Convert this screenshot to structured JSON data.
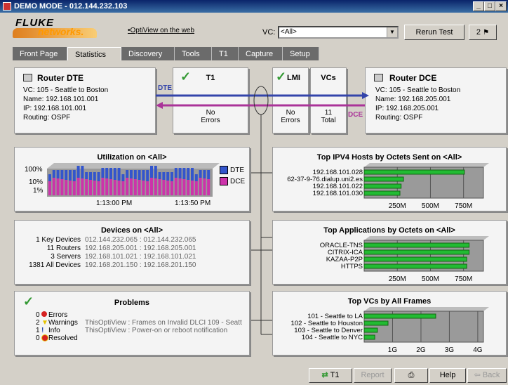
{
  "window": {
    "title": "DEMO MODE - 012.144.232.103",
    "min": "_",
    "max": "□",
    "close": "×"
  },
  "header": {
    "logo_top": "FLUKE",
    "logo_bottom": "networks.",
    "web_link": "OptiView on the web",
    "vc_label": "VC:",
    "vc_value": "<All>",
    "rerun_label": "Rerun Test",
    "alert_count": "2"
  },
  "tabs": [
    "Front Page",
    "Statistics",
    "Discovery",
    "Tools",
    "T1",
    "Capture",
    "Setup"
  ],
  "router_dte": {
    "title": "Router DTE",
    "vc": "VC: 105 - Seattle to Boston",
    "name": "Name: 192.168.101.001",
    "ip": "IP: 192.168.101.001",
    "routing": "Routing: OSPF"
  },
  "t1": {
    "title": "T1",
    "status1": "No",
    "status2": "Errors"
  },
  "lmi": {
    "title": "LMI",
    "status1": "No",
    "status2": "Errors"
  },
  "vcs": {
    "title": "VCs",
    "count": "11",
    "total": "Total"
  },
  "router_dce": {
    "title": "Router DCE",
    "vc": "VC: 105 - Seattle to Boston",
    "name": "Name: 192.168.205.001",
    "ip": "IP: 192.168.205.001",
    "routing": "Routing: OSPF"
  },
  "link": {
    "dte": "DTE",
    "dce": "DCE"
  },
  "utilization": {
    "title": "Utilization on <All>",
    "ylabels": [
      "100%",
      "10%",
      "1%"
    ],
    "xlabels": [
      "1:13:00 PM",
      "1:13:50 PM"
    ],
    "legend": [
      {
        "name": "DTE",
        "color": "#3355cc"
      },
      {
        "name": "DCE",
        "color": "#cc33aa"
      }
    ]
  },
  "devices": {
    "title": "Devices on <All>",
    "rows": [
      {
        "label": "1 Key Devices",
        "value": "012.144.232.065 : 012.144.232.065"
      },
      {
        "label": "11 Routers",
        "value": "192.168.205.001 : 192.168.205.001"
      },
      {
        "label": "3 Servers",
        "value": "192.168.101.021 : 192.168.101.021"
      },
      {
        "label": "1381 All Devices",
        "value": "192.168.201.150 : 192.168.201.150"
      }
    ]
  },
  "problems": {
    "title": "Problems",
    "rows": [
      {
        "count": "0",
        "label": "Errors",
        "detail": ""
      },
      {
        "count": "2",
        "label": "Warnings",
        "detail": "ThisOptiView : Frames on Invalid DLCI 109 - Seatt"
      },
      {
        "count": "1",
        "label": "Info",
        "detail": "ThisOptiView : Power-on or reboot notification"
      },
      {
        "count": "0",
        "label": "Resolved",
        "detail": ""
      }
    ]
  },
  "top_hosts": {
    "title": "Top IPV4 Hosts by Octets Sent on <All>",
    "xlabels": [
      "250M",
      "500M",
      "750M"
    ]
  },
  "top_apps": {
    "title": "Top Applications by Octets on <All>",
    "xlabels": [
      "250M",
      "500M",
      "750M"
    ]
  },
  "top_vcs": {
    "title": "Top VCs by All Frames",
    "xlabels": [
      "1G",
      "2G",
      "3G",
      "4G"
    ]
  },
  "chart_data": [
    {
      "type": "bar",
      "title": "Top IPV4 Hosts by Octets Sent on <All>",
      "categories": [
        "192.168.101.028",
        "62-37-9-76.dialup.uni2.es",
        "192.168.101.022",
        "192.168.101.030"
      ],
      "values": [
        840,
        330,
        310,
        300
      ],
      "xlim": [
        0,
        1000
      ]
    },
    {
      "type": "bar",
      "title": "Top Applications by Octets on <All>",
      "categories": [
        "ORACLE-TNS",
        "CITRIX-ICA",
        "KAZAA-P2P",
        "HTTPS"
      ],
      "values": [
        880,
        880,
        860,
        860
      ],
      "xlim": [
        0,
        1000
      ]
    },
    {
      "type": "bar",
      "title": "Top VCs by All Frames",
      "categories": [
        "101 - Seattle to LA",
        "102 - Seattle to Houston",
        "103 - Seattle to Denver",
        "104 - Seattle to NYC"
      ],
      "values": [
        2700,
        900,
        500,
        400
      ],
      "xlim": [
        0,
        4500
      ]
    }
  ],
  "bottom": {
    "t1": "T1",
    "report": "Report",
    "help": "Help",
    "back": "Back"
  }
}
